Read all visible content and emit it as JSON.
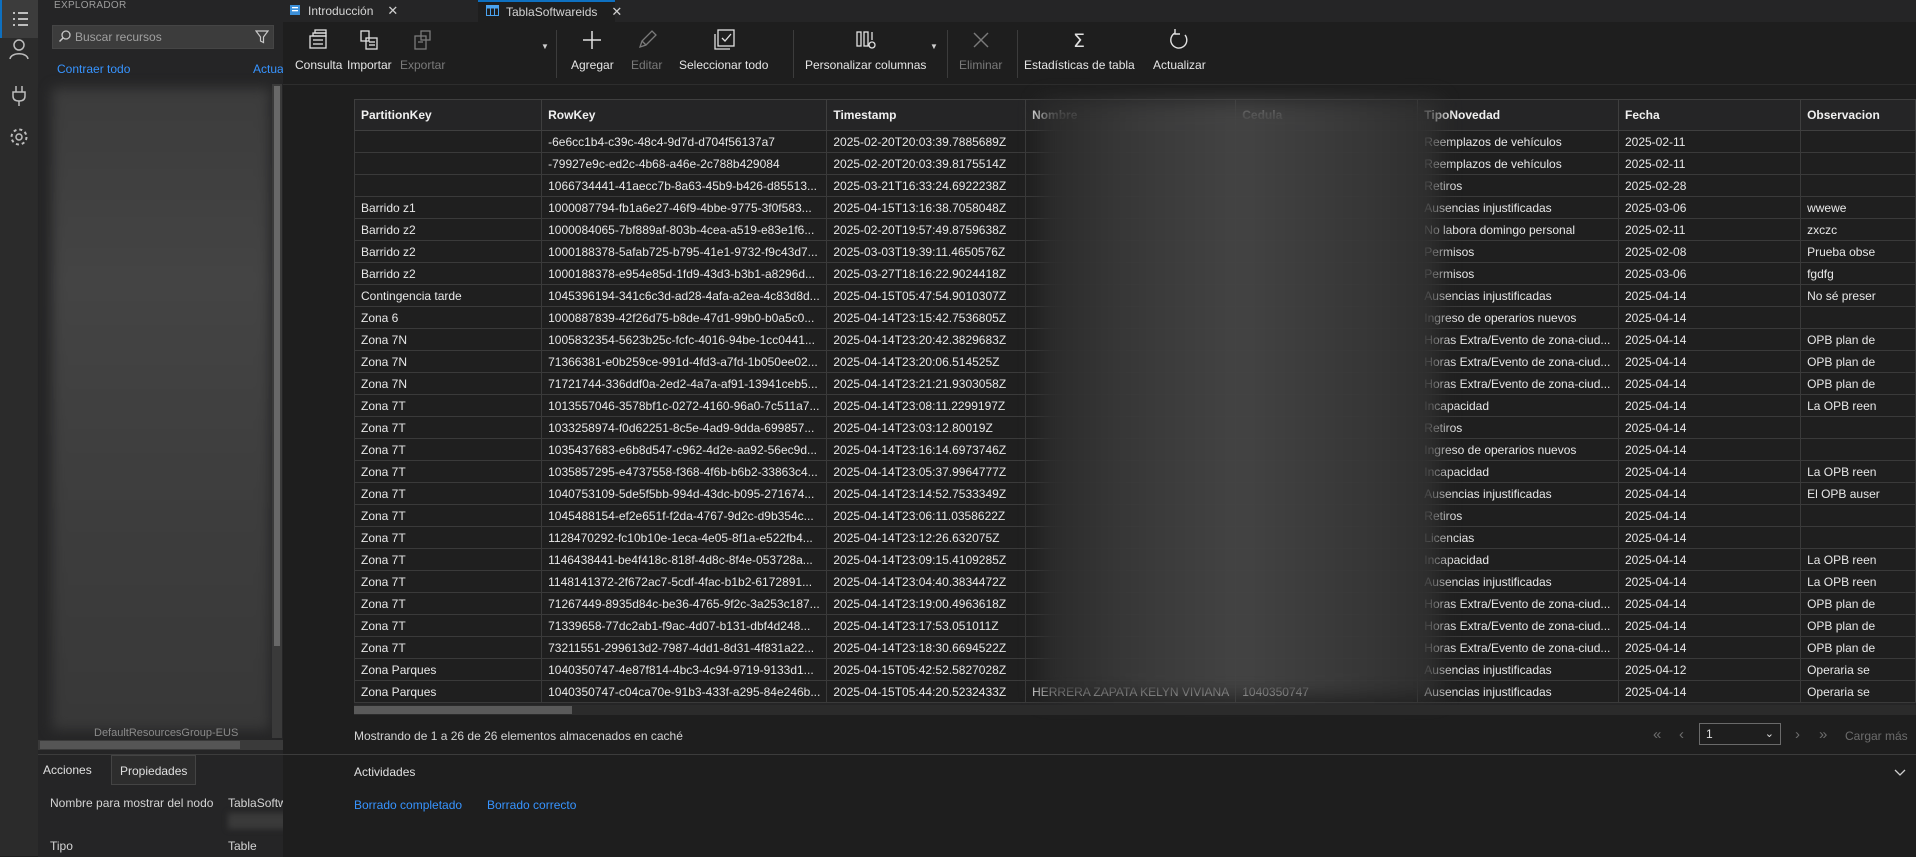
{
  "activity_bar": {
    "icons": [
      "explorer-icon",
      "account-icon",
      "plug-icon",
      "gear-icon"
    ]
  },
  "explorer": {
    "title": "EXPLORADOR",
    "search_placeholder": "Buscar recursos",
    "collapse_all": "Contraer todo",
    "refresh_all": "Actualizar todo",
    "tree_fragment": "DefaultResourcesGroup-EUS"
  },
  "props_panel": {
    "tabs": [
      "Acciones",
      "Propiedades"
    ],
    "rows": [
      {
        "label": "Nombre para mostrar del nodo",
        "value": "TablaSoftwareids"
      },
      {
        "label": "Tipo",
        "value": "Table"
      }
    ]
  },
  "tabs": [
    {
      "label": "Introducción",
      "icon": "document-icon"
    },
    {
      "label": "TablaSoftwareids",
      "icon": "table-icon",
      "active": true
    }
  ],
  "toolbar": {
    "consulta": "Consulta",
    "importar": "Importar",
    "exportar": "Exportar",
    "agregar": "Agregar",
    "editar": "Editar",
    "seleccionar_todo": "Seleccionar todo",
    "personalizar": "Personalizar columnas",
    "eliminar": "Eliminar",
    "estadisticas": "Estadísticas de tabla",
    "actualizar": "Actualizar"
  },
  "grid": {
    "columns": [
      "PartitionKey",
      "RowKey",
      "Timestamp",
      "Nombre",
      "Cedula",
      "TipoNovedad",
      "Fecha",
      "Observacion"
    ],
    "rows": [
      [
        "",
        "-6e6cc1b4-c39c-48c4-9d7d-d704f56137a7",
        "2025-02-20T20:03:39.7885689Z",
        "",
        "",
        "Reemplazos de vehículos",
        "2025-02-11",
        ""
      ],
      [
        "",
        "-79927e9c-ed2c-4b68-a46e-2c788b429084",
        "2025-02-20T20:03:39.8175514Z",
        "",
        "",
        "Reemplazos de vehículos",
        "2025-02-11",
        ""
      ],
      [
        "",
        "1066734441-41aecc7b-8a63-45b9-b426-d85513...",
        "2025-03-21T16:33:24.6922238Z",
        "",
        "",
        "Retiros",
        "2025-02-28",
        ""
      ],
      [
        "Barrido z1",
        "1000087794-fb1a6e27-46f9-4bbe-9775-3f0f583...",
        "2025-04-15T13:16:38.7058048Z",
        "",
        "",
        "Ausencias injustificadas",
        "2025-03-06",
        "wwewe"
      ],
      [
        "Barrido z2",
        "1000084065-7bf889af-803b-4cea-a519-e83e1f6...",
        "2025-02-20T19:57:49.8759638Z",
        "",
        "",
        "No labora domingo personal",
        "2025-02-11",
        "zxczc"
      ],
      [
        "Barrido z2",
        "1000188378-5afab725-b795-41e1-9732-f9c43d7...",
        "2025-03-03T19:39:11.4650576Z",
        "",
        "",
        "Permisos",
        "2025-02-08",
        "Prueba obse"
      ],
      [
        "Barrido z2",
        "1000188378-e954e85d-1fd9-43d3-b3b1-a8296d...",
        "2025-03-27T18:16:22.9024418Z",
        "",
        "",
        "Permisos",
        "2025-03-06",
        "fgdfg"
      ],
      [
        "Contingencia tarde",
        "1045396194-341c6c3d-ad28-4afa-a2ea-4c83d8d...",
        "2025-04-15T05:47:54.9010307Z",
        "",
        "",
        "Ausencias injustificadas",
        "2025-04-14",
        "No sé preser"
      ],
      [
        "Zona 6",
        "1000887839-42f26d75-b8de-47d1-99b0-b0a5c0...",
        "2025-04-14T23:15:42.7536805Z",
        "",
        "",
        "Ingreso de operarios nuevos",
        "2025-04-14",
        ""
      ],
      [
        "Zona 7N",
        "1005832354-5623b25c-fcfc-4016-94be-1cc0441...",
        "2025-04-14T23:20:42.3829683Z",
        "",
        "",
        "Horas Extra/Evento de zona-ciud...",
        "2025-04-14",
        "OPB plan de"
      ],
      [
        "Zona 7N",
        "71366381-e0b259ce-991d-4fd3-a7fd-1b050ee02...",
        "2025-04-14T23:20:06.514525Z",
        "",
        "",
        "Horas Extra/Evento de zona-ciud...",
        "2025-04-14",
        "OPB plan de"
      ],
      [
        "Zona 7N",
        "71721744-336ddf0a-2ed2-4a7a-af91-13941ceb5...",
        "2025-04-14T23:21:21.9303058Z",
        "",
        "",
        "Horas Extra/Evento de zona-ciud...",
        "2025-04-14",
        "OPB plan de"
      ],
      [
        "Zona 7T",
        "1013557046-3578bf1c-0272-4160-96a0-7c511a7...",
        "2025-04-14T23:08:11.2299197Z",
        "",
        "",
        "Incapacidad",
        "2025-04-14",
        "La OPB reen"
      ],
      [
        "Zona 7T",
        "1033258974-f0d62251-8c5e-4ad9-9dda-699857...",
        "2025-04-14T23:03:12.80019Z",
        "",
        "",
        "Retiros",
        "2025-04-14",
        ""
      ],
      [
        "Zona 7T",
        "1035437683-e6b8d547-c962-4d2e-aa92-56ec9d...",
        "2025-04-14T23:16:14.6973746Z",
        "",
        "",
        "Ingreso de operarios nuevos",
        "2025-04-14",
        ""
      ],
      [
        "Zona 7T",
        "1035857295-e4737558-f368-4f6b-b6b2-33863c4...",
        "2025-04-14T23:05:37.9964777Z",
        "",
        "",
        "Incapacidad",
        "2025-04-14",
        "La OPB reen"
      ],
      [
        "Zona 7T",
        "1040753109-5de5f5bb-994d-43dc-b095-271674...",
        "2025-04-14T23:14:52.7533349Z",
        "",
        "",
        "Ausencias injustificadas",
        "2025-04-14",
        "El OPB auser"
      ],
      [
        "Zona 7T",
        "1045488154-ef2e651f-f2da-4767-9d2c-d9b354c...",
        "2025-04-14T23:06:11.0358622Z",
        "",
        "",
        "Retiros",
        "2025-04-14",
        ""
      ],
      [
        "Zona 7T",
        "1128470292-fc10b10e-1eca-4e05-8f1a-e522fb4...",
        "2025-04-14T23:12:26.632075Z",
        "",
        "",
        "Licencias",
        "2025-04-14",
        ""
      ],
      [
        "Zona 7T",
        "1146438441-be4f418c-818f-4d8c-8f4e-053728a...",
        "2025-04-14T23:09:15.4109285Z",
        "",
        "",
        "Incapacidad",
        "2025-04-14",
        "La OPB reen"
      ],
      [
        "Zona 7T",
        "1148141372-2f672ac7-5cdf-4fac-b1b2-6172891...",
        "2025-04-14T23:04:40.3834472Z",
        "",
        "",
        "Ausencias injustificadas",
        "2025-04-14",
        "La OPB reen"
      ],
      [
        "Zona 7T",
        "71267449-8935d84c-be36-4765-9f2c-3a253c187...",
        "2025-04-14T23:19:00.4963618Z",
        "",
        "",
        "Horas Extra/Evento de zona-ciud...",
        "2025-04-14",
        "OPB plan de"
      ],
      [
        "Zona 7T",
        "71339658-77dc2ab1-f9ac-4d07-b131-dbf4d248...",
        "2025-04-14T23:17:53.051011Z",
        "",
        "",
        "Horas Extra/Evento de zona-ciud...",
        "2025-04-14",
        "OPB plan de"
      ],
      [
        "Zona 7T",
        "73211551-299613d2-7987-4dd1-8d31-4f831a22...",
        "2025-04-14T23:18:30.6694522Z",
        "",
        "",
        "Horas Extra/Evento de zona-ciud...",
        "2025-04-14",
        "OPB plan de"
      ],
      [
        "Zona Parques",
        "1040350747-4e87f814-4bc3-4c94-9719-9133d1...",
        "2025-04-15T05:42:52.5827028Z",
        "",
        "",
        "Ausencias injustificadas",
        "2025-04-12",
        "Operaria se"
      ],
      [
        "Zona Parques",
        "1040350747-c04ca70e-91b3-433f-a295-84e246b...",
        "2025-04-15T05:44:20.5232433Z",
        "HERRERA ZAPATA KELYN VIVIANA",
        "1040350747",
        "Ausencias injustificadas",
        "2025-04-14",
        "Operaria se"
      ]
    ]
  },
  "status": {
    "text": "Mostrando de 1 a 26 de 26 elementos almacenados en caché",
    "page": "1",
    "load_more": "Cargar más"
  },
  "activities": {
    "title": "Actividades",
    "items": [
      "Borrado completado",
      "Borrado correcto"
    ]
  },
  "colors": {
    "accent": "#3794ff",
    "bg": "#1e1e1e",
    "panel": "#252526"
  }
}
